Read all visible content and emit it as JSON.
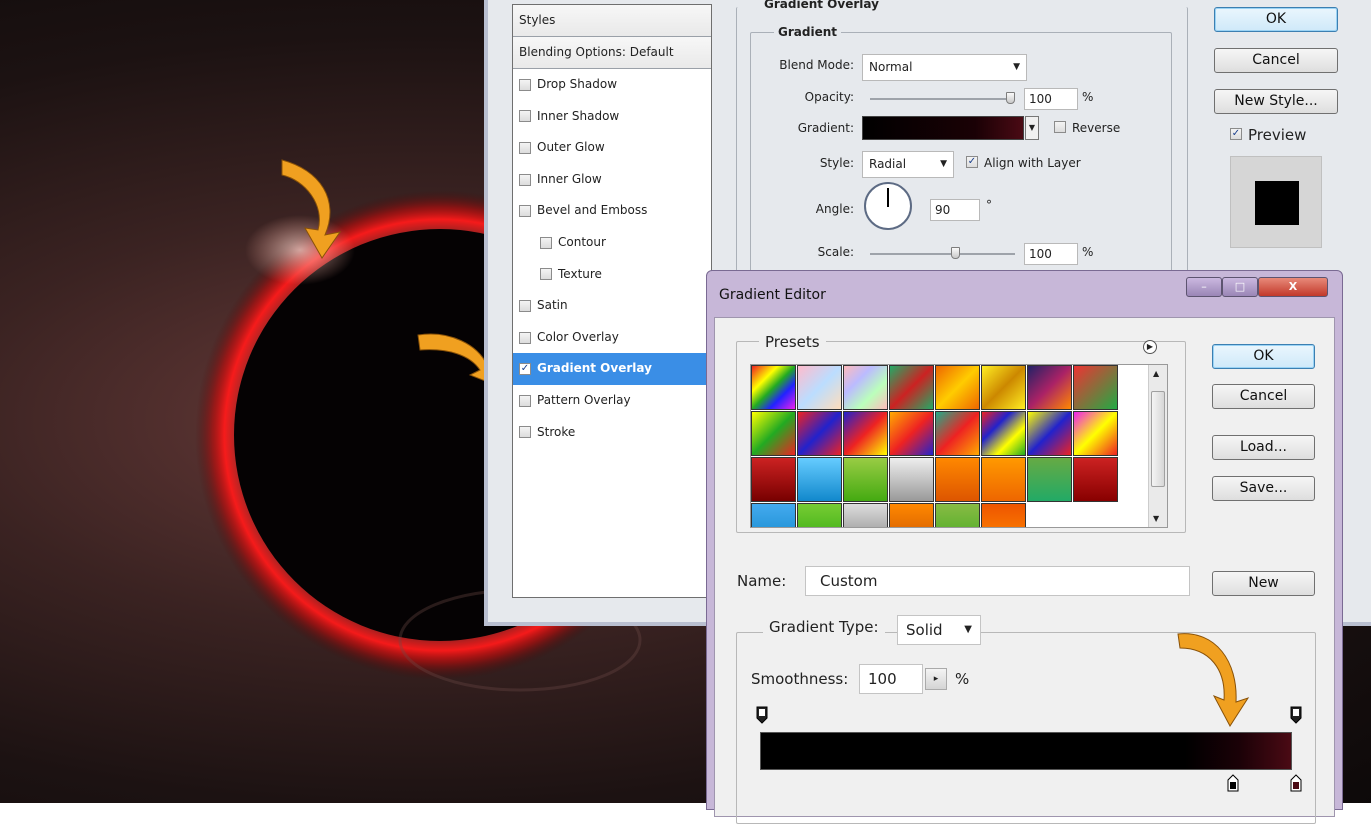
{
  "layer_style": {
    "styles_header": "Styles",
    "blending_options": "Blending Options: Default",
    "items": [
      {
        "label": "Drop Shadow",
        "checked": false,
        "indent": false
      },
      {
        "label": "Inner Shadow",
        "checked": false,
        "indent": false
      },
      {
        "label": "Outer Glow",
        "checked": false,
        "indent": false
      },
      {
        "label": "Inner Glow",
        "checked": false,
        "indent": false
      },
      {
        "label": "Bevel and Emboss",
        "checked": false,
        "indent": false
      },
      {
        "label": "Contour",
        "checked": false,
        "indent": true
      },
      {
        "label": "Texture",
        "checked": false,
        "indent": true
      },
      {
        "label": "Satin",
        "checked": false,
        "indent": false
      },
      {
        "label": "Color Overlay",
        "checked": false,
        "indent": false
      },
      {
        "label": "Gradient Overlay",
        "checked": true,
        "indent": false,
        "selected": true
      },
      {
        "label": "Pattern Overlay",
        "checked": false,
        "indent": false
      },
      {
        "label": "Stroke",
        "checked": false,
        "indent": false
      }
    ],
    "section_title": "Gradient Overlay",
    "group_title": "Gradient",
    "blend_mode_label": "Blend Mode:",
    "blend_mode_value": "Normal",
    "opacity_label": "Opacity:",
    "opacity_value": "100",
    "percent": "%",
    "gradient_label": "Gradient:",
    "reverse_label": "Reverse",
    "reverse_checked": false,
    "style_label": "Style:",
    "style_value": "Radial",
    "align_label": "Align with Layer",
    "align_checked": true,
    "angle_label": "Angle:",
    "angle_value": "90",
    "degree": "°",
    "scale_label": "Scale:",
    "scale_value": "100",
    "ok": "OK",
    "cancel": "Cancel",
    "new_style": "New Style...",
    "preview_label": "Preview",
    "preview_checked": true
  },
  "gradient_editor": {
    "title": "Gradient Editor",
    "presets_label": "Presets",
    "ok": "OK",
    "cancel": "Cancel",
    "load": "Load...",
    "save": "Save...",
    "name_label": "Name:",
    "name_value": "Custom",
    "new": "New",
    "gradient_type_label": "Gradient Type:",
    "gradient_type_value": "Solid",
    "smoothness_label": "Smoothness:",
    "smoothness_value": "100",
    "percent": "%",
    "window_buttons": [
      "–",
      "□",
      "X"
    ]
  },
  "colors": {
    "accent_selected": "#3a8ee6",
    "gradient_start": "#000000",
    "gradient_end": "#4a0a14",
    "glow": "#ff1a1a",
    "arrow": "#f0a020"
  }
}
